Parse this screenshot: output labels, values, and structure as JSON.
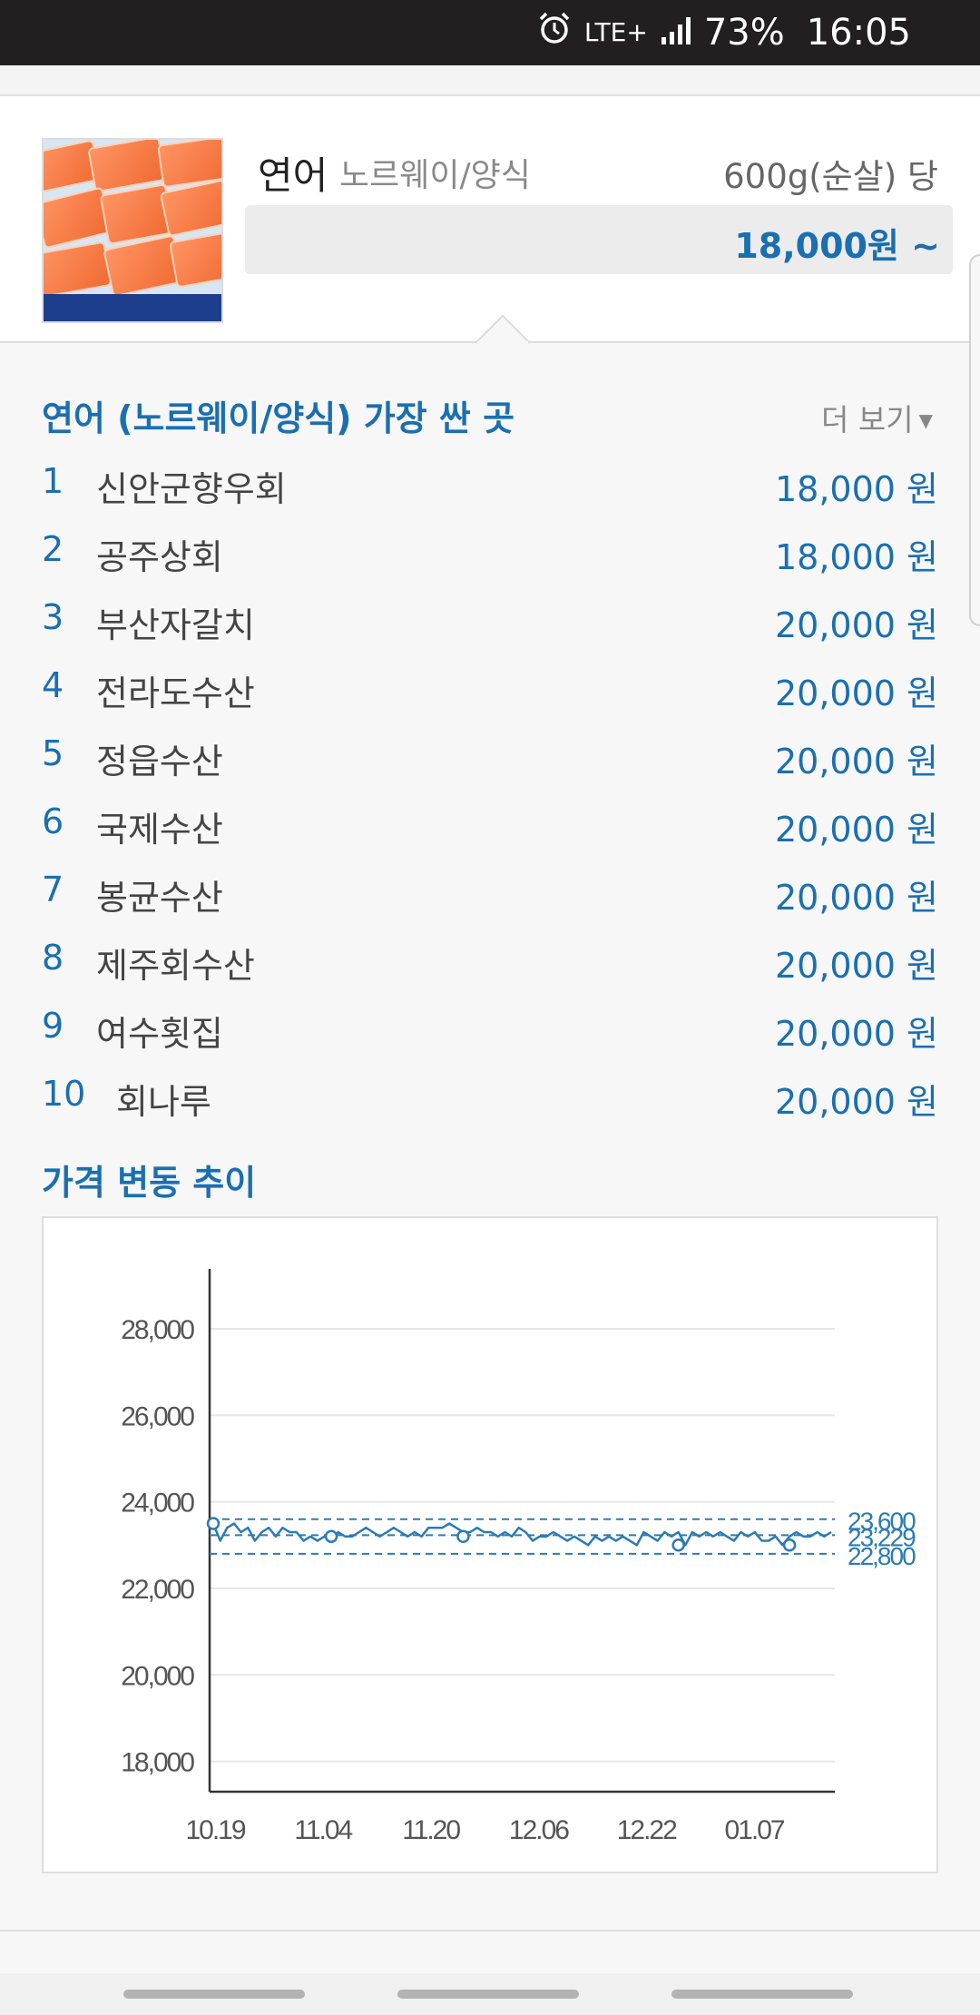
{
  "status_bar": {
    "icons": [
      "alarm-icon",
      "lte-plus-icon",
      "signal-icon"
    ],
    "network": "LTE+",
    "battery": "73%",
    "time": "16:05"
  },
  "product": {
    "name": "연어",
    "origin": "노르웨이/양식",
    "unit": "600g(순살) 당",
    "price_from": "18,000원 ~"
  },
  "cheapest": {
    "title": "연어 (노르웨이/양식) 가장 싼 곳",
    "more_label": "더 보기",
    "items": [
      {
        "rank": "1",
        "name": "신안군향우회",
        "price": "18,000 원"
      },
      {
        "rank": "2",
        "name": "공주상회",
        "price": "18,000 원"
      },
      {
        "rank": "3",
        "name": "부산자갈치",
        "price": "20,000 원"
      },
      {
        "rank": "4",
        "name": "전라도수산",
        "price": "20,000 원"
      },
      {
        "rank": "5",
        "name": "정읍수산",
        "price": "20,000 원"
      },
      {
        "rank": "6",
        "name": "국제수산",
        "price": "20,000 원"
      },
      {
        "rank": "7",
        "name": "봉균수산",
        "price": "20,000 원"
      },
      {
        "rank": "8",
        "name": "제주회수산",
        "price": "20,000 원"
      },
      {
        "rank": "9",
        "name": "여수횟집",
        "price": "20,000 원"
      },
      {
        "rank": "10",
        "name": "회나루",
        "price": "20,000 원"
      }
    ]
  },
  "trend": {
    "title": "가격 변동 추이"
  },
  "colors": {
    "accent": "#1a6fb0",
    "line": "#2b7bb5"
  },
  "chart_data": {
    "type": "line",
    "title": "",
    "xlabel": "",
    "ylabel": "",
    "ylim": [
      17300,
      29300
    ],
    "yticks": [
      "28,000",
      "26,000",
      "24,000",
      "22,000",
      "20,000",
      "18,000"
    ],
    "ytick_values": [
      28000,
      26000,
      24000,
      22000,
      20000,
      18000
    ],
    "xticks": [
      "10.19",
      "11.04",
      "11.20",
      "12.06",
      "12.22",
      "01.07"
    ],
    "grid": true,
    "reference_lines": [
      {
        "label": "23,600",
        "value": 23600,
        "style": "dashed"
      },
      {
        "label": "23,229",
        "value": 23229,
        "style": "dashed"
      },
      {
        "label": "22,800",
        "value": 22800,
        "style": "dashed"
      }
    ],
    "series": [
      {
        "values": [
          23500,
          23100,
          23400,
          23500,
          23300,
          23400,
          23100,
          23300,
          23400,
          23200,
          23400,
          23300,
          23300,
          23100,
          23200,
          23100,
          23200,
          23100,
          23300,
          23200,
          23200,
          23300,
          23400,
          23300,
          23200,
          23300,
          23400,
          23300,
          23200,
          23300,
          23200,
          23400,
          23400,
          23400,
          23500,
          23400,
          23300,
          23300,
          23400,
          23300,
          23300,
          23200,
          23300,
          23200,
          23400,
          23300,
          23100,
          23200,
          23200,
          23300,
          23200,
          23100,
          23200,
          23100,
          23000,
          23200,
          23100,
          23200,
          23100,
          23200,
          23100,
          23000,
          23300,
          23200,
          23100,
          23300,
          23200,
          23300,
          23000,
          23300,
          23200,
          23300,
          23200,
          23300,
          23200,
          23100,
          23300,
          23200,
          23300,
          23100,
          23100,
          23200,
          23000,
          23200,
          23300,
          23200,
          23200,
          23300,
          23200,
          23300
        ]
      }
    ],
    "markers": [
      {
        "index": 0,
        "value": 23500
      },
      {
        "index": 17,
        "value": 23200
      },
      {
        "index": 36,
        "value": 23200
      },
      {
        "index": 67,
        "value": 23000
      },
      {
        "index": 83,
        "value": 23000
      }
    ]
  }
}
